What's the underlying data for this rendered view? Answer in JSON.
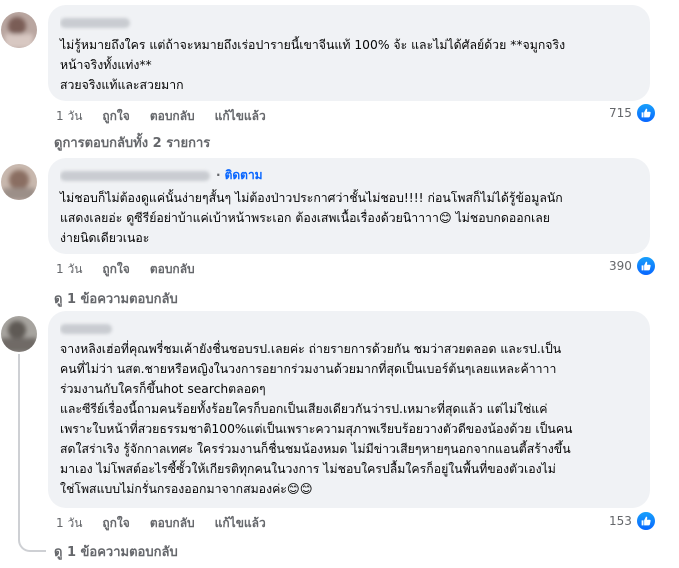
{
  "comments": [
    {
      "author_visible": "",
      "follow_label": "",
      "lines": [
        "ไม่รู้หมายถึงใคร แต่ถ้าจะหมายถึงเร่อปารายนี้เขาจีนแท้ 100% จ้ะ และไม่ได้ศัลย์ด้วย **จมูกจริง",
        "หน้าจริงทั้งแท่ง**",
        "สวยจริงแท้และสวยมาก"
      ],
      "time": "1 วัน",
      "like_label": "ถูกใจ",
      "reply_label": "ตอบกลับ",
      "edited_label": "แก้ไขแล้ว",
      "reaction_count": "715",
      "replies_label": "ดูการตอบกลับทั้ง 2 รายการ"
    },
    {
      "author_visible": "",
      "follow_label": "ติดตาม",
      "lines": [
        "ไม่ชอบก็ไม่ต้องดูแค่นั้นง่ายๆสั้นๆ ไม่ต้องป่าวประกาศว่าชั้นไม่ชอบ!!!! ก่อนโพสก็ไม่ได้รู้ข้อมูลนัก",
        "แสดงเลยอ่ะ ดูซีรีย์อย่าบ้าแค่เบ้าหน้าพระเอก ต้องเสพเนื้อเรื่องด้วยนิาาาา😊 ไม่ชอบกดออกเลย",
        "ง่ายนิดเดียวเนอะ"
      ],
      "time": "1 วัน",
      "like_label": "ถูกใจ",
      "reply_label": "ตอบกลับ",
      "edited_label": "",
      "reaction_count": "390",
      "replies_label": "ดู 1 ข้อความตอบกลับ"
    },
    {
      "author_visible": "",
      "follow_label": "",
      "lines": [
        "จางหลิงเฮ่อที่คุณพรี่ชมเค้ายังชื่นชอบรป.เลยค่ะ ถ่ายรายการด้วยกัน ชมว่าสวยตลอด และรป.เป็น",
        "คนที่ไม่ว่า นสต.ชายหรือหญิงในวงการอยากร่วมงานด้วยมากที่สุดเป็นเบอร์ต้นๆเลยแหละค้าาาา",
        "ร่วมงานกับใครก็ขึ้นhot searchตลอดๆ",
        "และซีรีย์เรื่องนี้ถามคนร้อยทั้งร้อยใครก็บอกเป็นเสียงเดียวกันว่ารป.เหมาะที่สุดแล้ว แต่ไม่ใช่แค่",
        "เพราะใบหน้าที่สวยธรรมชาติ100%แต่เป็นเพราะความสุภาพเรียบร้อยวางตัวดีของน้องด้วย เป็นคน",
        "สดใสร่าเริง รู้จักกาลเทศะ ใครร่วมงานก็ชื่นชมน้องหมด ไม่มีข่าวเสียๆหายๆนอกจากแอนตี้สร้างขึ้น",
        "มาเอง ไม่โพสต์อะไรซี้ซั้วให้เกียรติทุกคนในวงการ ไม่ชอบใครปลื้มใครก็อยู่ในพื้นที่ของตัวเองไม่",
        "ใช่โพสแบบไม่กรั่นกรองออกมาจากสมองค่ะ😊😊"
      ],
      "time": "1 วัน",
      "like_label": "ถูกใจ",
      "reply_label": "ตอบกลับ",
      "edited_label": "แก้ไขแล้ว",
      "reaction_count": "153",
      "replies_label": "ดู 1 ข้อความตอบกลับ"
    }
  ],
  "colors": {
    "bubble": "#f0f2f5",
    "meta": "#65676b",
    "like": "#0866ff"
  },
  "icons": {
    "like": "thumbs-up-icon",
    "avatar": "blurred-avatar"
  }
}
